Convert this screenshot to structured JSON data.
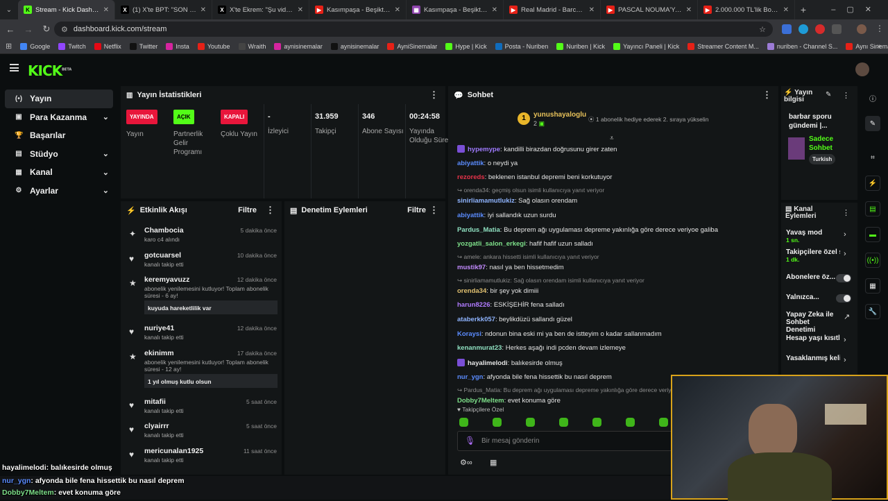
{
  "browser": {
    "tabs": [
      {
        "title": "Stream - Kick Dashboard",
        "fav": "K",
        "favbg": "#53fc18",
        "favfg": "#000"
      },
      {
        "title": "(1) X'te BPT: \"SON DAKİKA",
        "fav": "X",
        "favbg": "#000",
        "favfg": "#fff"
      },
      {
        "title": "X'te Ekrem: \"Şu videoyu S",
        "fav": "X",
        "favbg": "#000",
        "favfg": "#fff"
      },
      {
        "title": "Kasımpaşa - Beşiktaş Maç",
        "fav": "▶",
        "favbg": "#e62117",
        "favfg": "#fff"
      },
      {
        "title": "Kasımpaşa - Beşiktaş Maç",
        "fav": "▦",
        "favbg": "#8e44ad",
        "favfg": "#fff"
      },
      {
        "title": "Real Madrid - Barcelona",
        "fav": "▶",
        "favbg": "#e62117",
        "favfg": "#fff"
      },
      {
        "title": "PASCAL NOUMA'YA MEY",
        "fav": "▶",
        "favbg": "#e62117",
        "favfg": "#fff"
      },
      {
        "title": "2.000.000 TL'lik Bozkurt",
        "fav": "▶",
        "favbg": "#e62117",
        "favfg": "#fff"
      }
    ],
    "new_tab": "+",
    "url": "dashboard.kick.com/stream",
    "bookmarks": [
      {
        "label": "Google",
        "color": "#4285f4"
      },
      {
        "label": "Twitch",
        "color": "#9146ff"
      },
      {
        "label": "Netflix",
        "color": "#e50914"
      },
      {
        "label": "Twitter",
        "color": "#111"
      },
      {
        "label": "Insta",
        "color": "#d6249f"
      },
      {
        "label": "Youtube",
        "color": "#e62117"
      },
      {
        "label": "Wraith",
        "color": "#444"
      },
      {
        "label": "aynisinemalar",
        "color": "#d6249f"
      },
      {
        "label": "aynisinemalar",
        "color": "#111"
      },
      {
        "label": "AyniSinemalar",
        "color": "#e62117"
      },
      {
        "label": "Hype | Kick",
        "color": "#53fc18"
      },
      {
        "label": "Posta - Nuriben",
        "color": "#0f6cbd"
      },
      {
        "label": "Nuriben | Kick",
        "color": "#53fc18"
      },
      {
        "label": "Yayıncı Paneli | Kick",
        "color": "#53fc18"
      },
      {
        "label": "Streamer Content M...",
        "color": "#e62117"
      },
      {
        "label": "nuriben - Channel S...",
        "color": "#9c7bd6"
      },
      {
        "label": "Aynı Sinemalar - Ça...",
        "color": "#e62117"
      }
    ]
  },
  "brand": {
    "logo": "KICK",
    "beta": "BETA"
  },
  "sidebar": [
    {
      "label": "Yayın",
      "icon": "(•)",
      "active": true,
      "chev": false
    },
    {
      "label": "Para Kazanma",
      "icon": "▣",
      "active": false,
      "chev": true
    },
    {
      "label": "Başarılar",
      "icon": "🏆",
      "active": false,
      "chev": false
    },
    {
      "label": "Stüdyo",
      "icon": "▤",
      "active": false,
      "chev": true
    },
    {
      "label": "Kanal",
      "icon": "▦",
      "active": false,
      "chev": true
    },
    {
      "label": "Ayarlar",
      "icon": "⚙",
      "active": false,
      "chev": true
    }
  ],
  "stats": {
    "title": "Yayın İstatistikleri",
    "items": [
      {
        "badge": "YAYINDA",
        "badge_bg": "#e8163b",
        "badge_fg": "#fff",
        "label": "Yayın"
      },
      {
        "badge": "AÇIK",
        "badge_bg": "#53fc18",
        "badge_fg": "#000",
        "label": "Partnerlik Gelir Programı"
      },
      {
        "badge": "KAPALI",
        "badge_bg": "#e8163b",
        "badge_fg": "#fff",
        "label": "Çoklu Yayın"
      },
      {
        "value": "-",
        "label": "İzleyici"
      },
      {
        "value": "31.959",
        "label": "Takipçi"
      },
      {
        "value": "346",
        "label": "Abone Sayısı"
      },
      {
        "value": "00:24:58",
        "label": "Yayında Olduğu Süre"
      }
    ]
  },
  "activity": {
    "title": "Etkinlik Akışı",
    "filter": "Filtre",
    "items": [
      {
        "user": "Chambocia",
        "time": "5 dakika önce",
        "text": "karo c4 alındı",
        "icon": "✦",
        "quote": ""
      },
      {
        "user": "gotcuarsel",
        "time": "10 dakika önce",
        "text": "kanalı takip etti",
        "icon": "♥",
        "quote": ""
      },
      {
        "user": "keremyavuzz",
        "time": "12 dakika önce",
        "text": "abonelik yenilemesini kutluyor! Toplam abonelik süresi - 6 ay!",
        "icon": "★",
        "quote": "kuyuda hareketlilik var"
      },
      {
        "user": "nuriye41",
        "time": "12 dakika önce",
        "text": "kanalı takip etti",
        "icon": "♥",
        "quote": ""
      },
      {
        "user": "ekinimm",
        "time": "17 dakika önce",
        "text": "abonelik yenilemesini kutluyor! Toplam abonelik süresi - 12 ay!",
        "icon": "★",
        "quote": "1 yıl olmuş kutlu olsun"
      },
      {
        "user": "mitafii",
        "time": "5 saat önce",
        "text": "kanalı takip etti",
        "icon": "♥",
        "quote": ""
      },
      {
        "user": "clyairrr",
        "time": "5 saat önce",
        "text": "kanalı takip etti",
        "icon": "♥",
        "quote": ""
      },
      {
        "user": "mericunalan1925",
        "time": "11 saat önce",
        "text": "kanalı takip etti",
        "icon": "♥",
        "quote": ""
      }
    ]
  },
  "moderation": {
    "title": "Denetim Eylemleri",
    "filter": "Filtre"
  },
  "chat": {
    "title": "Sohbet",
    "pinned_user": "yunushayaloglu",
    "pinned_count": "2",
    "pinned_note": "1 abonelik hediye ederek 2. sıraya yükselin",
    "messages": [
      {
        "user": "hypemype",
        "color": "#9f7bff",
        "text": "kandilli birazdan doğrusunu girer zaten",
        "reply": "",
        "badge": true
      },
      {
        "user": "abiyattik",
        "color": "#5b8cff",
        "text": "o neydi ya",
        "reply": ""
      },
      {
        "user": "rezoreds",
        "color": "#e8334a",
        "text": "beklenen istanbul depremi beni korkutuyor",
        "reply": ""
      },
      {
        "user": "sinirliamamutlukiz",
        "color": "#8fb4ff",
        "text": "Sağ olasın orendam",
        "reply": "orenda34: geçmiş olsun isimli kullanıcıya yanıt veriyor"
      },
      {
        "user": "abiyattik",
        "color": "#5b8cff",
        "text": "iyi sallandık uzun surdu",
        "reply": ""
      },
      {
        "user": "Pardus_Matia",
        "color": "#8fe0c0",
        "text": "Bu deprem ağı uygulaması depreme yakınlığa göre derece veriyoe galiba",
        "reply": ""
      },
      {
        "user": "yozgatli_salon_erkegi",
        "color": "#7ee08a",
        "text": "hafif hafif uzun salladı",
        "reply": ""
      },
      {
        "user": "mustik97",
        "color": "#c38bff",
        "text": "nasıl ya ben hissetmedim",
        "reply": "amele: ankara hissetti isimli kullanıcıya yanıt veriyor"
      },
      {
        "user": "orenda34",
        "color": "#e0c070",
        "text": "bir şey yok dimiii",
        "reply": "sinirliamamutlukiz: Sağ olasın orendam isimli kullanıcıya yanıt veriyor"
      },
      {
        "user": "harun8226",
        "color": "#b07bff",
        "text": "ESKİŞEHİR fena salladı",
        "reply": ""
      },
      {
        "user": "ataberkk057",
        "color": "#8fb4ff",
        "text": "beylikdüzü sallandı güzel",
        "reply": ""
      },
      {
        "user": "Koraysi",
        "color": "#5b8cff",
        "text": "ndonun bina eski mi ya ben de istteyim o kadar sallanmadım",
        "reply": ""
      },
      {
        "user": "kenanmurat23",
        "color": "#8fe0c0",
        "text": "Herkes aşağı indi pcden devam izlemeye",
        "reply": ""
      },
      {
        "user": "hayalimelodi",
        "color": "#e6e6e6",
        "text": "balıkesirde olmuş",
        "reply": "",
        "badge": true
      },
      {
        "user": "nur_ygn",
        "color": "#5b8cff",
        "text": "afyonda bile fena hissettik bu nasıl deprem",
        "reply": ""
      },
      {
        "user": "Dobby7Meltem",
        "color": "#7ee08a",
        "text": "evet konuma göre",
        "reply": "Pardus_Matia: Bu deprem ağı uygulaması depreme yakınlığa göre derece veriy"
      }
    ],
    "followers_only": "Takipçilere Özel",
    "input_placeholder": "Bir mesaj gönderin"
  },
  "stream_info": {
    "title": "Yayın bilgisi",
    "stream_title": "barbar sporu gündemi |...",
    "category": "Sadece Sohbet",
    "language": "Turkish"
  },
  "channel_actions": {
    "title": "Kanal Eylemleri",
    "items": [
      {
        "label": "Yavaş mod",
        "sub": "1 sn.",
        "control": "arrow"
      },
      {
        "label": "Takipçilere özel s",
        "sub": "1 dk.",
        "control": "arrow"
      },
      {
        "label": "Abonelere öz...",
        "sub": "",
        "control": "toggle"
      },
      {
        "label": "Yalnızca...",
        "sub": "",
        "control": "toggle"
      },
      {
        "label": "Yapay Zeka ile Sohbet Denetimi",
        "sub": "",
        "control": "ext"
      },
      {
        "label": "Hesap yaşı kısıtla",
        "sub": "",
        "control": "arrow"
      },
      {
        "label": "Yasaklanmış kelin",
        "sub": "",
        "control": "arrow"
      }
    ]
  },
  "overlay": [
    {
      "user": "hayalimelodi",
      "color": "#ffffff",
      "text": ": balıkesirde olmuş"
    },
    {
      "user": "nur_ygn",
      "color": "#5b8cff",
      "text": ": afyonda bile fena hissettik bu nasıl deprem"
    },
    {
      "user": "Dobby7Meltem",
      "color": "#7ee08a",
      "text": ": evet konuma göre"
    }
  ]
}
